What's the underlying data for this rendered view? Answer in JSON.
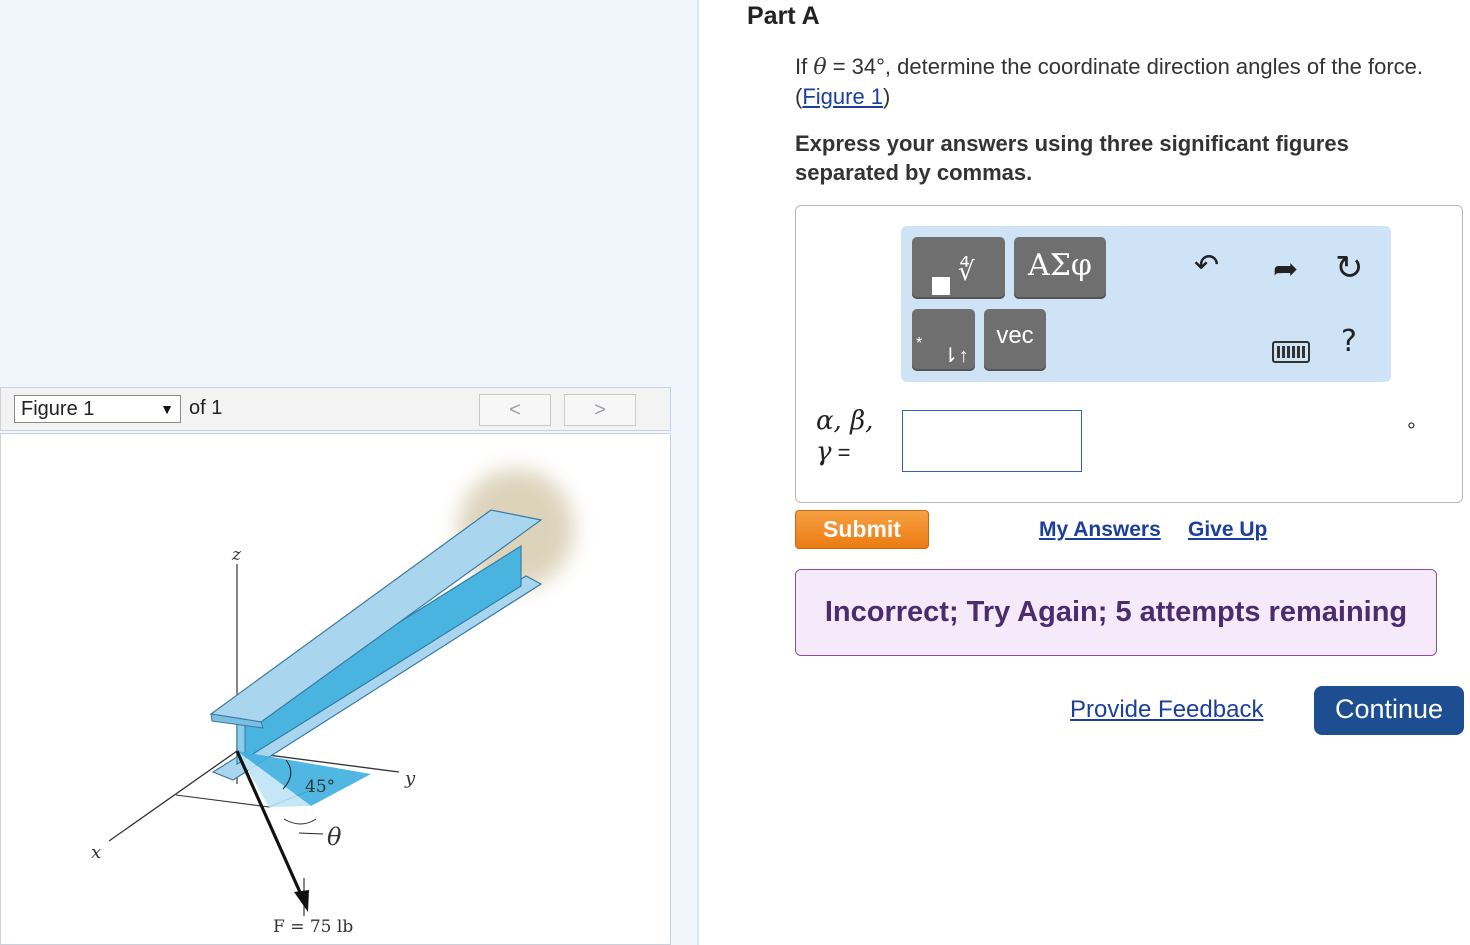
{
  "figure_viewer": {
    "selected_figure": "Figure 1",
    "of_label": "of 1",
    "prev_label": "<",
    "next_label": ">",
    "labels": {
      "z_axis": "z",
      "y_axis": "y",
      "x_axis": "x",
      "angle_45": "45°",
      "theta": "θ",
      "force": "F = 75 lb"
    }
  },
  "part": {
    "title": "Part A",
    "question_prefix": "If ",
    "question_theta": "θ",
    "question_middle": " = 34°, determine the coordinate direction angles of the force. (",
    "figure_link": "Figure 1",
    "question_suffix": ")",
    "instructions": "Express your answers using three significant figures separated by commas."
  },
  "equation_toolbar": {
    "templates_radical": "∜",
    "greek_label": "ΑΣφ",
    "subscript_glyph_1": "*",
    "subscript_glyph_2": "⇂↑",
    "vec_label": "vec",
    "undo_icon": "↶",
    "redo_icon": "➦",
    "reset_icon": "↻",
    "keyboard_icon": "keyboard",
    "help_icon": "?"
  },
  "answer": {
    "label_line1": "α, β,",
    "label_gamma": "γ",
    "label_equals": " =",
    "value": "",
    "unit": "°"
  },
  "actions": {
    "submit_label": "Submit",
    "my_answers_label": "My Answers",
    "give_up_label": "Give Up",
    "feedback_message": "Incorrect; Try Again; 5 attempts remaining",
    "provide_feedback_label": "Provide Feedback",
    "continue_label": "Continue"
  },
  "colors": {
    "submit": "#ec7c12",
    "continue": "#1e4e92",
    "feedback_bg": "#f6e9fa",
    "toolbar_bg": "#cfe3f7",
    "beam": "#a9d6ee"
  }
}
